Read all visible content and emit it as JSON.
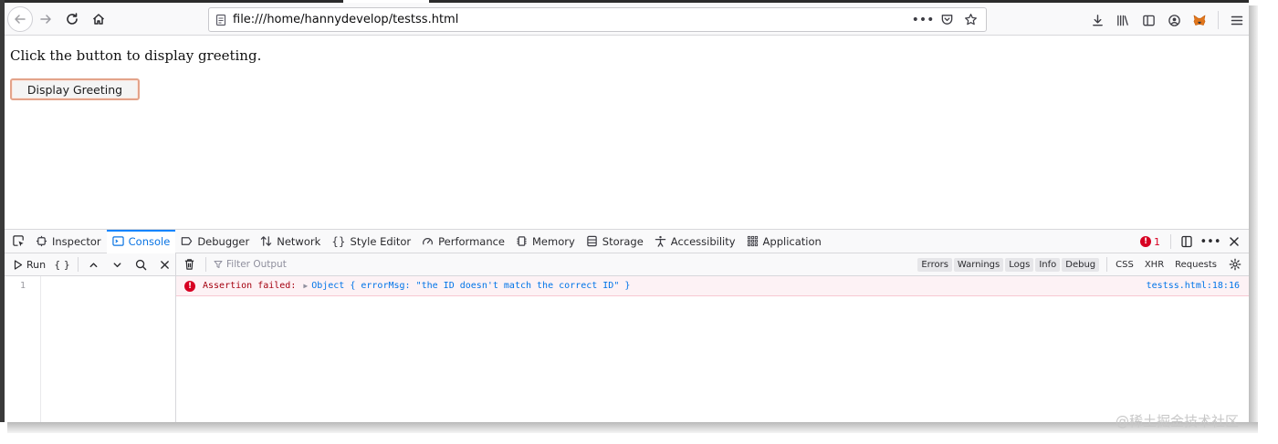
{
  "browser": {
    "url": "file:///home/hannydevelop/testss.html"
  },
  "page": {
    "intro_text": "Click the button to display greeting.",
    "button_label": "Display Greeting"
  },
  "devtools": {
    "tabs": [
      {
        "label": "Inspector",
        "icon": "inspector-icon"
      },
      {
        "label": "Console",
        "icon": "console-icon",
        "active": true
      },
      {
        "label": "Debugger",
        "icon": "debugger-icon"
      },
      {
        "label": "Network",
        "icon": "network-icon"
      },
      {
        "label": "Style Editor",
        "icon": "braces-icon"
      },
      {
        "label": "Performance",
        "icon": "performance-icon"
      },
      {
        "label": "Memory",
        "icon": "memory-icon"
      },
      {
        "label": "Storage",
        "icon": "storage-icon"
      },
      {
        "label": "Accessibility",
        "icon": "accessibility-icon"
      },
      {
        "label": "Application",
        "icon": "application-icon"
      }
    ],
    "error_count": "1",
    "editor": {
      "run_label": "Run",
      "pretty_label": "{ }",
      "line_number": "1"
    },
    "console": {
      "filter_placeholder": "Filter Output",
      "filters": [
        "Errors",
        "Warnings",
        "Logs",
        "Info",
        "Debug"
      ],
      "extra_filters": [
        "CSS",
        "XHR",
        "Requests"
      ],
      "message": {
        "prefix": "Assertion failed:",
        "object": "Object { errorMsg: \"the ID doesn't match the correct ID\" }",
        "location": "testss.html:18:16"
      }
    }
  },
  "watermark": "@稀土掘金技术社区",
  "colors": {
    "accent": "#0a84ff",
    "error": "#d70022",
    "error_bg": "#fdf2f5"
  }
}
